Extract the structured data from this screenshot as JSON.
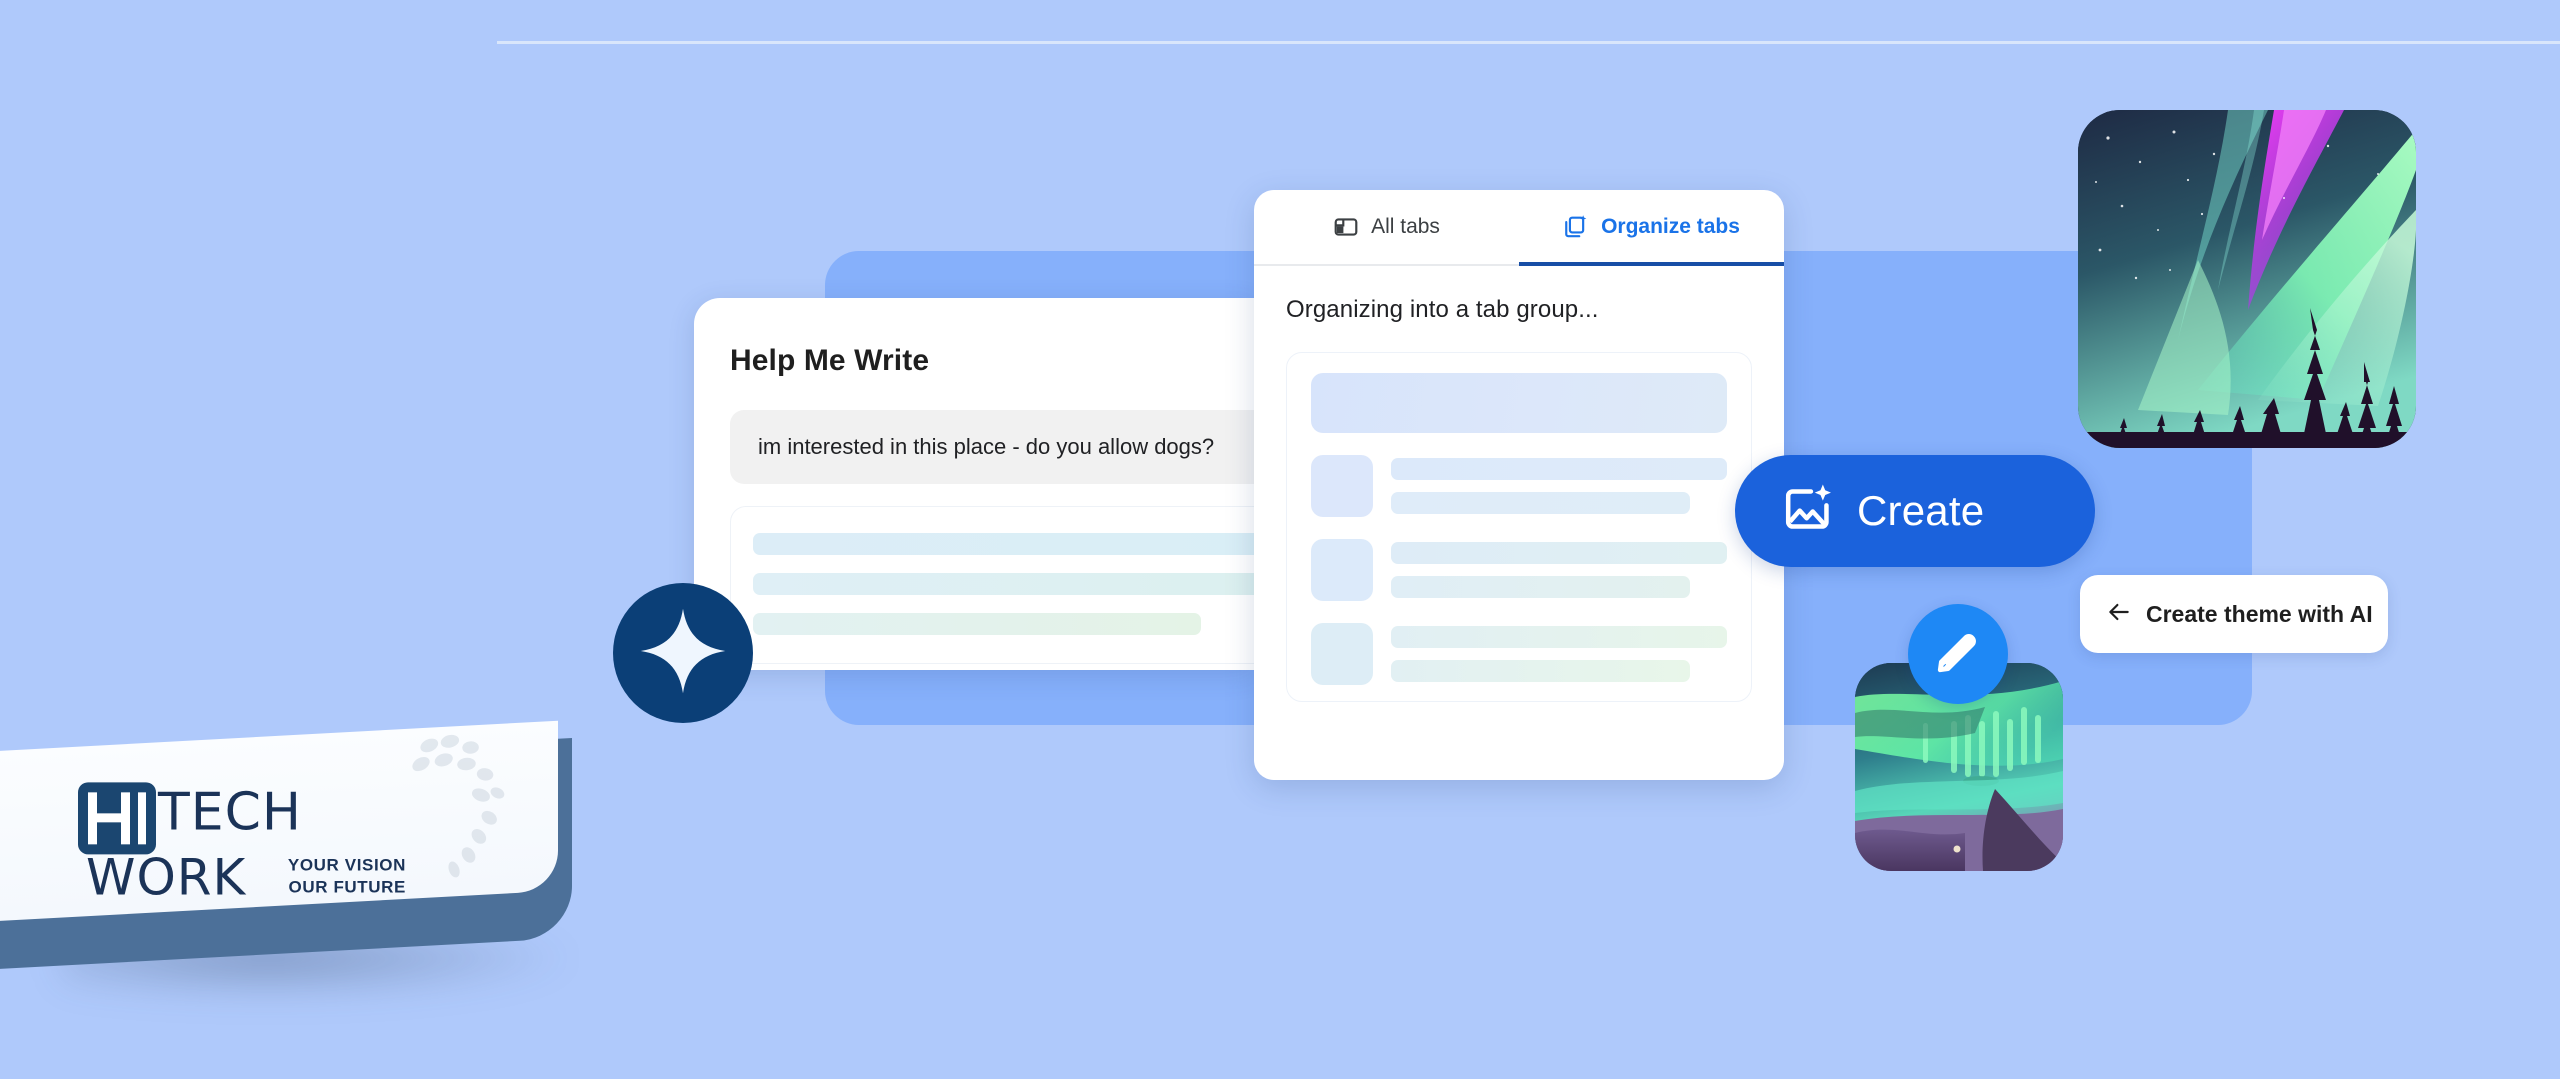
{
  "background": {
    "page_color": "#AFC9FB",
    "panel_color": "#86B0FB"
  },
  "help_me_write": {
    "title": "Help Me Write",
    "prompt_text": "im interested in this place - do you allow dogs?",
    "icons": {
      "sparkle": "sparkle-star-icon"
    }
  },
  "tabs_panel": {
    "tabs": [
      {
        "label": "All tabs",
        "icon": "browser-tab-icon",
        "active": false
      },
      {
        "label": "Organize tabs",
        "icon": "organize-tabs-sparkle-icon",
        "active": true
      }
    ],
    "status_text": "Organizing into a tab group...",
    "accent_color": "#1A73E8",
    "active_underline_color": "#174EA6",
    "skeleton_rows": 3
  },
  "create_button": {
    "label": "Create",
    "icon": "image-sparkle-icon",
    "color": "#1B62DC",
    "text_color": "#FFFFFF"
  },
  "theme_chip": {
    "label": "Create theme with AI",
    "icon": "arrow-left-icon"
  },
  "aurora_large": {
    "name": "aurora-borealis-forest-image",
    "description": "Starry night sky with magenta and green aurora over pine forest"
  },
  "aurora_small": {
    "name": "aurora-mountains-thumbnail",
    "description": "Green aurora over teal sky and purple mountains"
  },
  "edit_fab": {
    "icon": "pencil-icon",
    "color": "#1E88F5"
  },
  "logo": {
    "mark_letters": "HI",
    "word_top": "TECH",
    "word_bottom": "WORK",
    "tagline_line1": "YOUR VISION",
    "tagline_line2": "OUR FUTURE",
    "mark_color": "#1B4670",
    "text_color": "#1B3358"
  }
}
